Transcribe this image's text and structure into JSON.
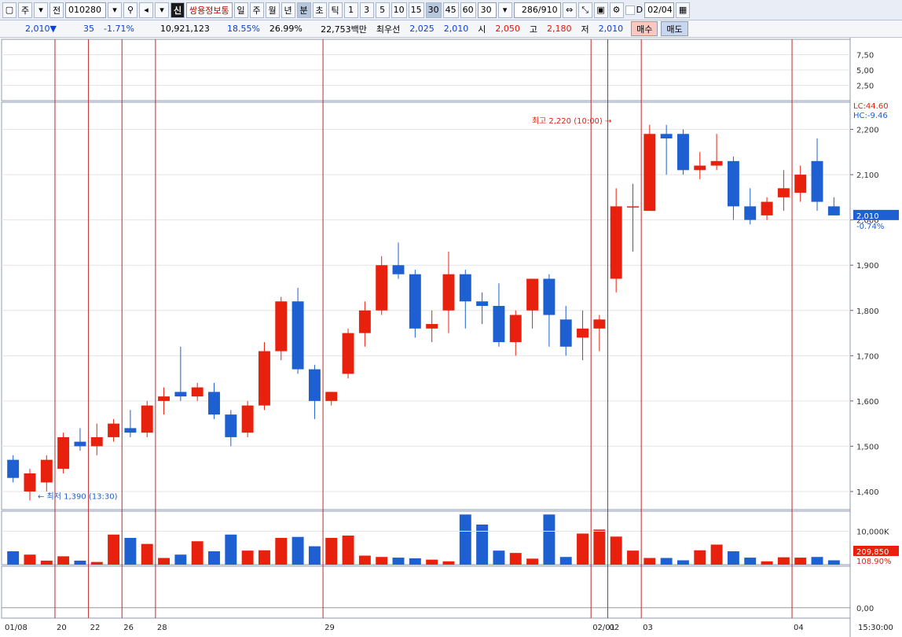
{
  "toolbar": {
    "market": "주",
    "prev_label": "전",
    "code": "010280",
    "new_badge": "신",
    "stock_name": "쌍용정보통",
    "periods": [
      "일",
      "주",
      "월",
      "년",
      "분",
      "초",
      "틱"
    ],
    "minutes": [
      "1",
      "3",
      "5",
      "10",
      "15",
      "30",
      "45",
      "60"
    ],
    "minute_value": "30",
    "count": "286/910",
    "checkbox_label": "D",
    "date": "02/04"
  },
  "quote": {
    "price": "2,010▼",
    "change": "35",
    "change_pct": "-1.71%",
    "volume": "10,921,123",
    "turnover_pct": "18.55%",
    "rate2": "26.99%",
    "amount": "22,753백만",
    "priority_label": "최우선",
    "ask": "2,025",
    "bid": "2,010",
    "open_label": "시",
    "open": "2,050",
    "high_label": "고",
    "high": "2,180",
    "low_label": "저",
    "low": "2,010",
    "buy_label": "매수",
    "sell_label": "매도"
  },
  "labels": {
    "lc": "LC:44.60",
    "hc": "HC:-9.46",
    "max_note": "최고 2,220 (10:00)",
    "min_note": "최저 1,390 (13:30)",
    "current_price": "2,010",
    "current_pct": "-0.74%",
    "vol_current": "209,850",
    "vol_pct": "108.90%",
    "time_end": "15:30:00"
  },
  "stoch_axis": [
    "7,50",
    "5,00",
    "2,50"
  ],
  "price_axis": [
    "2,200",
    "2,100",
    "2,000",
    "1,900",
    "1,800",
    "1,700",
    "1,600",
    "1,500",
    "1,400"
  ],
  "volume_axis": [
    "10,000K"
  ],
  "macd_axis": [
    "0,00"
  ],
  "date_labels": [
    "01/08",
    "20",
    "22",
    "26",
    "28",
    "29",
    "02/01",
    "02",
    "03",
    "04"
  ],
  "colors": {
    "up": "#e8200e",
    "down": "#1e5fd1",
    "vline": "#c0282a",
    "grid": "#e4e4e4"
  },
  "chart_data": {
    "type": "candlestick",
    "unit": "30-minute",
    "ylim": [
      1360,
      2260
    ],
    "candles": [
      {
        "o": 1470,
        "h": 1480,
        "l": 1420,
        "c": 1430
      },
      {
        "o": 1400,
        "h": 1450,
        "l": 1380,
        "c": 1440
      },
      {
        "o": 1420,
        "h": 1480,
        "l": 1400,
        "c": 1470
      },
      {
        "o": 1450,
        "h": 1530,
        "l": 1440,
        "c": 1520
      },
      {
        "o": 1510,
        "h": 1540,
        "l": 1490,
        "c": 1500
      },
      {
        "o": 1500,
        "h": 1550,
        "l": 1480,
        "c": 1520
      },
      {
        "o": 1520,
        "h": 1560,
        "l": 1510,
        "c": 1550
      },
      {
        "o": 1540,
        "h": 1580,
        "l": 1520,
        "c": 1530
      },
      {
        "o": 1530,
        "h": 1600,
        "l": 1520,
        "c": 1590
      },
      {
        "o": 1600,
        "h": 1630,
        "l": 1570,
        "c": 1610
      },
      {
        "o": 1620,
        "h": 1720,
        "l": 1600,
        "c": 1610
      },
      {
        "o": 1610,
        "h": 1640,
        "l": 1600,
        "c": 1630
      },
      {
        "o": 1620,
        "h": 1640,
        "l": 1560,
        "c": 1570
      },
      {
        "o": 1570,
        "h": 1580,
        "l": 1500,
        "c": 1520
      },
      {
        "o": 1530,
        "h": 1600,
        "l": 1520,
        "c": 1590
      },
      {
        "o": 1590,
        "h": 1730,
        "l": 1580,
        "c": 1710
      },
      {
        "o": 1710,
        "h": 1830,
        "l": 1690,
        "c": 1820
      },
      {
        "o": 1820,
        "h": 1850,
        "l": 1660,
        "c": 1670
      },
      {
        "o": 1670,
        "h": 1680,
        "l": 1560,
        "c": 1600
      },
      {
        "o": 1600,
        "h": 1620,
        "l": 1590,
        "c": 1620
      },
      {
        "o": 1660,
        "h": 1760,
        "l": 1650,
        "c": 1750
      },
      {
        "o": 1750,
        "h": 1820,
        "l": 1720,
        "c": 1800
      },
      {
        "o": 1800,
        "h": 1920,
        "l": 1790,
        "c": 1900
      },
      {
        "o": 1900,
        "h": 1950,
        "l": 1870,
        "c": 1880
      },
      {
        "o": 1880,
        "h": 1890,
        "l": 1740,
        "c": 1760
      },
      {
        "o": 1760,
        "h": 1800,
        "l": 1730,
        "c": 1770
      },
      {
        "o": 1800,
        "h": 1930,
        "l": 1750,
        "c": 1880
      },
      {
        "o": 1880,
        "h": 1890,
        "l": 1760,
        "c": 1820
      },
      {
        "o": 1820,
        "h": 1840,
        "l": 1770,
        "c": 1810
      },
      {
        "o": 1810,
        "h": 1860,
        "l": 1720,
        "c": 1730
      },
      {
        "o": 1730,
        "h": 1800,
        "l": 1700,
        "c": 1790
      },
      {
        "o": 1800,
        "h": 1830,
        "l": 1760,
        "c": 1870
      },
      {
        "o": 1870,
        "h": 1880,
        "l": 1720,
        "c": 1790
      },
      {
        "o": 1780,
        "h": 1810,
        "l": 1700,
        "c": 1720
      },
      {
        "o": 1740,
        "h": 1800,
        "l": 1690,
        "c": 1760
      },
      {
        "o": 1760,
        "h": 1790,
        "l": 1710,
        "c": 1780
      },
      {
        "o": 1870,
        "h": 2070,
        "l": 1840,
        "c": 2030
      },
      {
        "o": 2030,
        "h": 2080,
        "l": 1930,
        "c": 2030
      },
      {
        "o": 2020,
        "h": 2210,
        "l": 2020,
        "c": 2190
      },
      {
        "o": 2190,
        "h": 2210,
        "l": 2100,
        "c": 2180
      },
      {
        "o": 2190,
        "h": 2200,
        "l": 2100,
        "c": 2110
      },
      {
        "o": 2110,
        "h": 2150,
        "l": 2090,
        "c": 2120
      },
      {
        "o": 2120,
        "h": 2190,
        "l": 2110,
        "c": 2130
      },
      {
        "o": 2130,
        "h": 2140,
        "l": 2000,
        "c": 2030
      },
      {
        "o": 2030,
        "h": 2070,
        "l": 1990,
        "c": 2000
      },
      {
        "o": 2010,
        "h": 2050,
        "l": 2000,
        "c": 2040
      },
      {
        "o": 2050,
        "h": 2110,
        "l": 2020,
        "c": 2070
      },
      {
        "o": 2060,
        "h": 2120,
        "l": 2040,
        "c": 2100
      },
      {
        "o": 2130,
        "h": 2180,
        "l": 2020,
        "c": 2040
      },
      {
        "o": 2030,
        "h": 2050,
        "l": 2010,
        "c": 2010
      }
    ],
    "volumes": [
      400,
      300,
      120,
      250,
      120,
      80,
      900,
      800,
      620,
      200,
      300,
      700,
      400,
      900,
      420,
      430,
      800,
      830,
      550,
      800,
      870,
      270,
      230,
      210,
      190,
      150,
      100,
      1500,
      1200,
      420,
      350,
      180,
      1500,
      230,
      930,
      1050,
      840,
      420,
      200,
      200,
      130,
      430,
      600,
      400,
      210,
      100,
      220,
      210,
      230,
      130
    ],
    "stoch_lines": {
      "k": [],
      "d": []
    },
    "macd": {
      "hist": []
    }
  }
}
